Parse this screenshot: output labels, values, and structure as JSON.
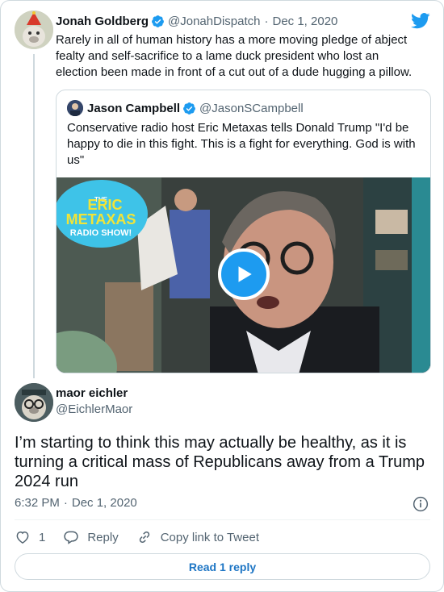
{
  "parent": {
    "name": "Jonah Goldberg",
    "handle": "@JonahDispatch",
    "date": "Dec 1, 2020",
    "text": "Rarely in all of human history has a more moving pledge of abject fealty and self-sacrifice to a lame duck president who lost an election been made in front of a cut out of a dude hugging a pillow."
  },
  "quoted": {
    "name": "Jason Campbell",
    "handle": "@JasonSCampbell",
    "text": "Conservative radio host Eric Metaxas tells Donald Trump \"I'd be happy to die in this fight. This is a fight for everything. God is with us\"",
    "media_logo": {
      "the": "THE",
      "line1": "ERIC",
      "line2": "METAXAS",
      "line3": "RADIO SHOW!"
    }
  },
  "reply": {
    "name": "maor eichler",
    "handle": "@EichlerMaor",
    "text": "I’m starting to think this may actually be healthy, as it is turning a critical mass of Republicans away from a Trump 2024 run",
    "time": "6:32 PM",
    "date": "Dec 1, 2020"
  },
  "actions": {
    "like_count": "1",
    "reply_label": "Reply",
    "copy_link_label": "Copy link to Tweet"
  },
  "read_replies_label": "Read 1 reply",
  "colors": {
    "accent": "#1d9bf0",
    "text": "#0f1419",
    "muted": "#536471",
    "border": "#cfd9de"
  },
  "icons": [
    "twitter-bird-icon",
    "verified-badge-icon",
    "play-icon",
    "info-icon",
    "heart-icon",
    "reply-icon",
    "link-icon"
  ]
}
